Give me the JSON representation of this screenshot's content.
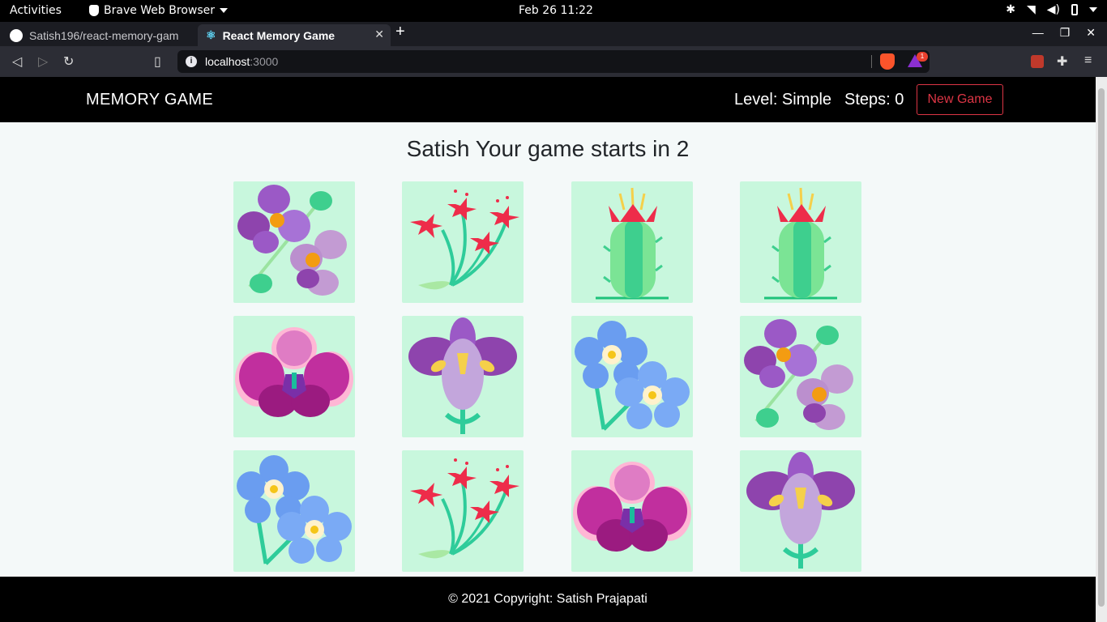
{
  "system": {
    "activities": "Activities",
    "app_name": "Brave Web Browser",
    "clock": "Feb 26  11:22"
  },
  "browser": {
    "tabs": [
      {
        "label": "Satish196/react-memory-gam",
        "icon": "github-icon"
      },
      {
        "label": "React Memory Game",
        "icon": "react-icon",
        "active": true
      }
    ],
    "url_host": "localhost",
    "url_port": ":3000",
    "rewards_badge": "1"
  },
  "header": {
    "brand": "MEMORY GAME",
    "level": "Level: Simple",
    "steps": "Steps: 0",
    "new_game": "New Game"
  },
  "main": {
    "title": "Satish Your game starts in 2"
  },
  "cards": [
    {
      "flower": "purple-violet-flower-icon"
    },
    {
      "flower": "red-star-flower-icon"
    },
    {
      "flower": "flowering-cactus-icon"
    },
    {
      "flower": "flowering-cactus-icon"
    },
    {
      "flower": "magenta-orchid-icon"
    },
    {
      "flower": "purple-iris-icon"
    },
    {
      "flower": "blue-forget-me-not-icon"
    },
    {
      "flower": "purple-violet-flower-icon"
    },
    {
      "flower": "blue-forget-me-not-icon"
    },
    {
      "flower": "red-star-flower-icon"
    },
    {
      "flower": "magenta-orchid-icon"
    },
    {
      "flower": "purple-iris-icon"
    }
  ],
  "footer": {
    "copyright": "© 2021 Copyright: Satish Prajapati"
  },
  "colors": {
    "card_bg": "#c8f7dd",
    "page_bg": "#f4f9f9",
    "accent_red": "#dc3545"
  }
}
